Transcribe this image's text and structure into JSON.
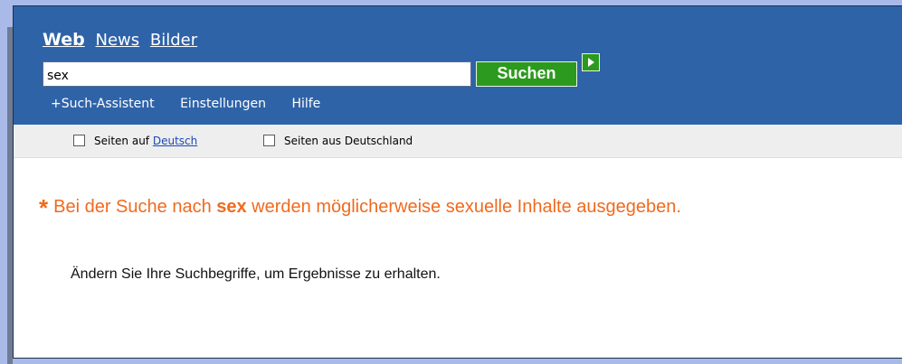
{
  "tabs": {
    "web": "Web",
    "news": "News",
    "bilder": "Bilder"
  },
  "search": {
    "value": "sex",
    "button_label": "Suchen"
  },
  "subnav": {
    "assistant": "+Such-Assistent",
    "settings": "Einstellungen",
    "help": "Hilfe"
  },
  "filters": {
    "german_prefix": "Seiten auf ",
    "german_link": "Deutsch",
    "germany": "Seiten aus Deutschland"
  },
  "notice": {
    "icon": "asterisk-icon",
    "prefix": "Bei der Suche nach ",
    "term": "sex",
    "suffix": " werden möglicherweise sexuelle Inhalte ausgegeben."
  },
  "hint": "Ändern Sie Ihre Suchbegriffe, um Ergebnisse zu erhalten.",
  "colors": {
    "header_bg": "#2f63a8",
    "button_green": "#2c9a1e",
    "notice_orange": "#f06a1e",
    "filter_bg": "#eeeeee",
    "outer_bg": "#a9b9e8"
  }
}
